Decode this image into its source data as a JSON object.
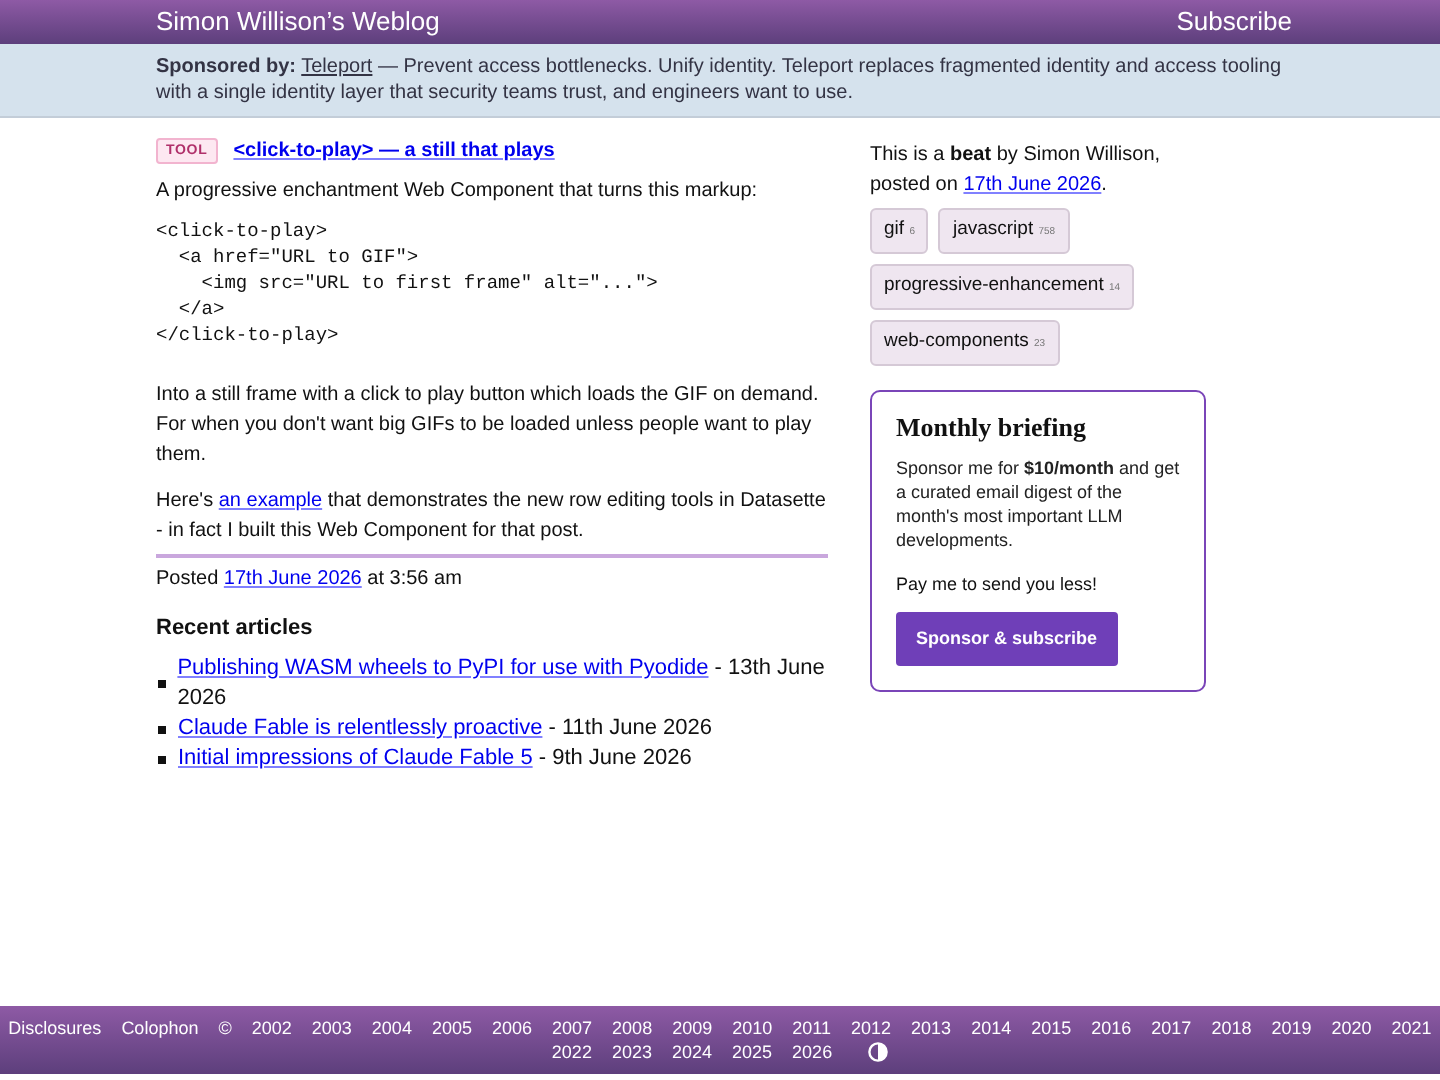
{
  "header": {
    "title": "Simon Willison’s Weblog",
    "subscribe": "Subscribe"
  },
  "sponsor": {
    "label": "Sponsored by:",
    "link": "Teleport",
    "text": " — Prevent access bottlenecks. Unify identity. Teleport replaces fragmented identity and access tooling with a single identity layer that security teams trust, and engineers want to use."
  },
  "post": {
    "badge": "TOOL",
    "title": "<click-to-play> — a still that plays",
    "intro": "A progressive enchantment Web Component that turns this markup:",
    "code": "<click-to-play>\n  <a href=\"URL to GIF\">\n    <img src=\"URL to first frame\" alt=\"...\">\n  </a>\n</click-to-play>",
    "paragraph": "Into a still frame with a click to play button which loads the GIF on demand. For when you don't want big GIFs to be loaded unless people want to play them.",
    "example": {
      "before": "Here's ",
      "link": "an example",
      "after": " that demonstrates the new row editing tools in Datasette - in fact I built this Web Component for that post."
    },
    "posted": {
      "before": "Posted ",
      "link": "17th June 2026",
      "after": " at 3:56 am"
    }
  },
  "recent": {
    "heading": "Recent articles",
    "items": [
      {
        "title": "Publishing WASM wheels to PyPI for use with Pyodide",
        "date": " - 13th June 2026"
      },
      {
        "title": "Claude Fable is relentlessly proactive",
        "date": " - 11th June 2026"
      },
      {
        "title": "Initial impressions of Claude Fable 5",
        "date": " - 9th June 2026"
      }
    ]
  },
  "sidebar": {
    "intro": "This is a **beat** by Simon Willison, posted on ",
    "date": "17th June 2026",
    "end": ".",
    "tags": [
      {
        "label": "gif",
        "count": "6"
      },
      {
        "label": "javascript",
        "count": "758"
      },
      {
        "label": "progressive-enhancement",
        "count": "14"
      },
      {
        "label": "web-components",
        "count": "23"
      }
    ],
    "briefing": {
      "title": "Monthly briefing",
      "text": "Sponsor me for **$10/month** and get a curated email digest of the month's most important LLM developments.",
      "note": "Pay me to send you less!",
      "button": "Sponsor & subscribe"
    }
  },
  "footer": {
    "links": [
      "Disclosures",
      "Colophon",
      "©",
      "2002",
      "2003",
      "2004",
      "2005",
      "2006",
      "2007",
      "2008",
      "2009",
      "2010",
      "2011",
      "2012",
      "2013",
      "2014",
      "2015",
      "2016",
      "2017",
      "2018",
      "2019",
      "2020",
      "2021",
      "2022",
      "2023",
      "2024",
      "2025",
      "2026"
    ]
  }
}
